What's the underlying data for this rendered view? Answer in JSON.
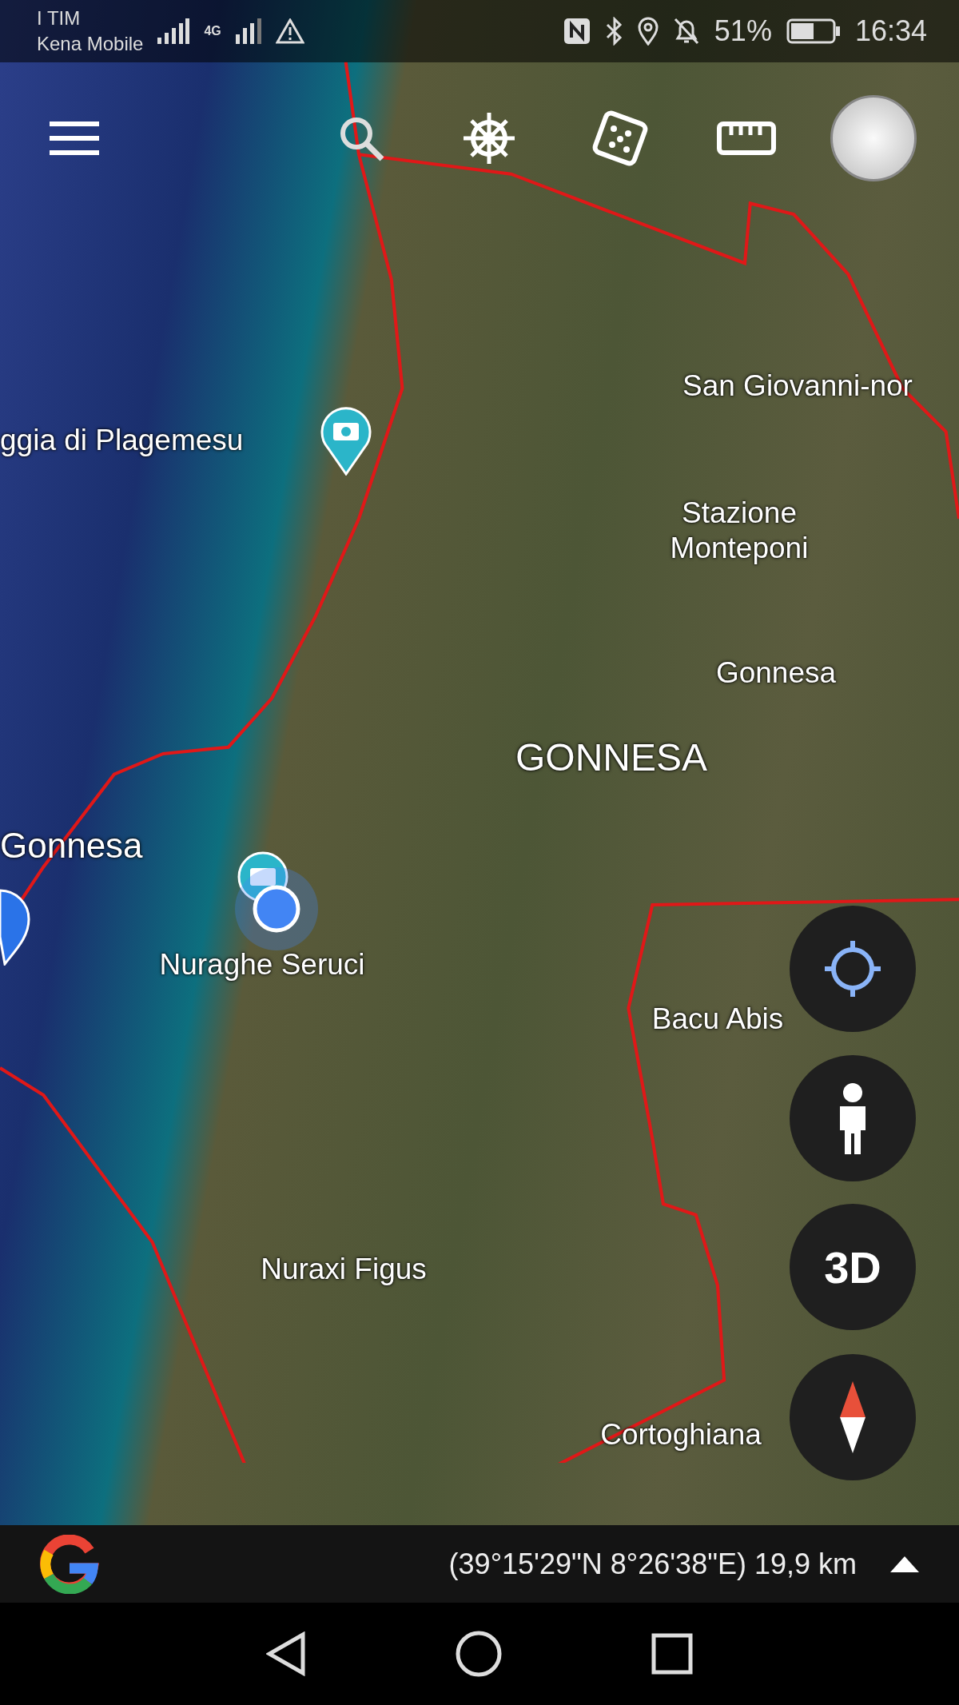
{
  "status_bar": {
    "carrier": "I TIM",
    "operator": "Kena Mobile",
    "network": "4G",
    "battery": "51%",
    "time": "16:34"
  },
  "map": {
    "labels": [
      {
        "text": "ggia di Plagemesu",
        "kind": "place"
      },
      {
        "text": "San Giovanni-nor",
        "kind": "place"
      },
      {
        "text": "Stazione\nMonteponi",
        "kind": "place"
      },
      {
        "text": "Gonnesa",
        "kind": "place"
      },
      {
        "text": "GONNESA",
        "kind": "region"
      },
      {
        "text": "Gonnesa",
        "kind": "large"
      },
      {
        "text": "Nuraghe Seruci",
        "kind": "place"
      },
      {
        "text": "Bacu Abis",
        "kind": "place"
      },
      {
        "text": "Nuraxi Figus",
        "kind": "place"
      },
      {
        "text": "Cortoghiana",
        "kind": "place"
      }
    ]
  },
  "side_buttons": [
    {
      "kind": "locate"
    },
    {
      "kind": "street-view"
    },
    {
      "kind": "text",
      "label": "3D"
    },
    {
      "kind": "compass"
    }
  ],
  "bottom_bar": {
    "coordinates": "(39°15'29\"N 8°26'38\"E) 19,9 km"
  }
}
